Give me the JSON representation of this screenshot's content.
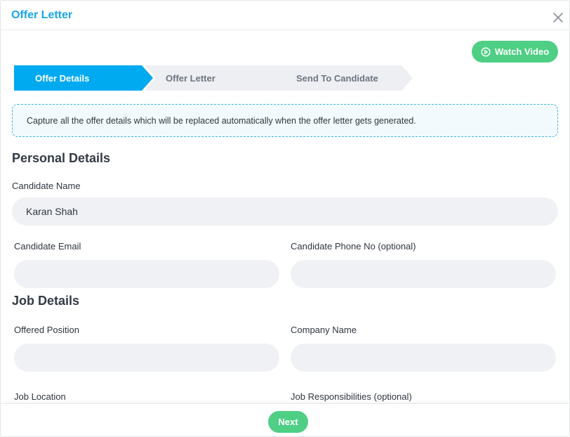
{
  "modal": {
    "title": "Offer Letter"
  },
  "toolbar": {
    "watch_video_label": "Watch Video"
  },
  "steps": [
    {
      "label": "Offer Details",
      "active": true
    },
    {
      "label": "Offer Letter",
      "active": false
    },
    {
      "label": "Send To Candidate",
      "active": false
    }
  ],
  "info": {
    "text": "Capture all the offer details which will be replaced automatically when the offer letter gets generated."
  },
  "personal": {
    "section_title": "Personal Details",
    "candidate_name_label": "Candidate Name",
    "candidate_name_value": "Karan Shah",
    "candidate_email_label": "Candidate Email",
    "candidate_email_value": "",
    "candidate_phone_label": "Candidate Phone No (optional)",
    "candidate_phone_value": ""
  },
  "job": {
    "section_title": "Job Details",
    "offered_position_label": "Offered Position",
    "offered_position_value": "",
    "company_name_label": "Company Name",
    "company_name_value": "",
    "job_location_label": "Job Location",
    "job_responsibilities_label": "Job Responsibilities (optional)"
  },
  "footer": {
    "next_label": "Next"
  },
  "colors": {
    "accent_blue": "#1aa6e8",
    "step_active": "#00aaf0",
    "step_inactive": "#edeff2",
    "green": "#4fcf85",
    "input_bg": "#eff1f4"
  }
}
